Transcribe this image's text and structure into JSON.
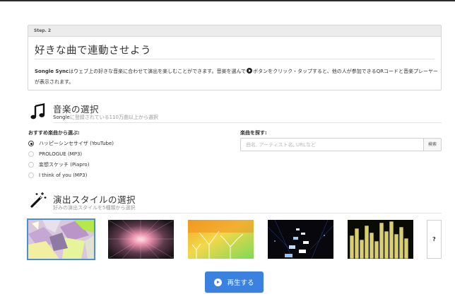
{
  "step": {
    "label": "Step. 2",
    "title": "好きな曲で連動させよう",
    "desc_brand": "Songle Sync",
    "desc_part1": "はウェブ上の好きな音楽に合わせて演出を楽しむことができます。音楽を選んで",
    "desc_part2": "ボタンをクリック・タップすると、他の人が参加できるQRコードと音楽プレーヤーが表示されます。"
  },
  "music": {
    "title": "音楽の選択",
    "subtitle_brand": "Songle",
    "subtitle_rest": "に登録されている110万曲以上から選択",
    "icon": "music-note-icon",
    "recommended_label": "おすすめ楽曲から選ぶ:",
    "options": [
      {
        "label": "ハッピーシンセサイザ (YouTube)",
        "checked": true
      },
      {
        "label": "PROLOGUE (MP3)",
        "checked": false
      },
      {
        "label": "妄想スケッチ (Piapro)",
        "checked": false
      },
      {
        "label": "I think of you (MP3)",
        "checked": false
      }
    ],
    "search_label": "楽曲を探す:",
    "search_placeholder": "曲名, アーティスト名, URLなど",
    "search_button": "検索"
  },
  "style": {
    "title": "演出スタイルの選択",
    "subtitle": "好みの演出スタイルを5種類から選択",
    "icon": "magic-wand-icon",
    "thumbnails": [
      "geometric-pastel",
      "radial-burst",
      "tree-gradient",
      "neon-grid",
      "spectrum-bars"
    ],
    "more_label": "?"
  },
  "actions": {
    "play_label": "再生する",
    "accent": "#3b82e0"
  }
}
